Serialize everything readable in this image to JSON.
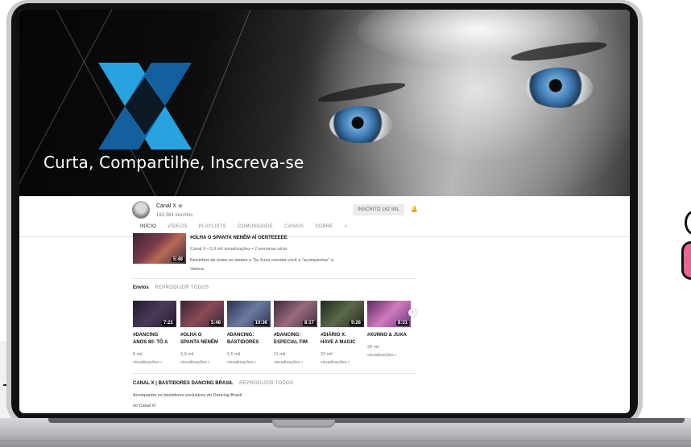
{
  "banner": {
    "tagline": "Curta, Compartilhe, Inscreva-se"
  },
  "channel": {
    "name": "Canal X",
    "subscribers": "162,384 inscritos",
    "subscribe_label": "INSCRITO 162 MIL",
    "tabs": [
      {
        "label": "INÍCIO",
        "active": true
      },
      {
        "label": "VÍDEOS",
        "active": false
      },
      {
        "label": "PLAYLISTS",
        "active": false
      },
      {
        "label": "COMUNIDADE",
        "active": false
      },
      {
        "label": "CANAIS",
        "active": false
      },
      {
        "label": "SOBRE",
        "active": false
      }
    ]
  },
  "featured": {
    "title": "#OLHA O SPANTA NENÊM AÍ GENTEEEEE",
    "meta": "Canal X • 5,9 mil visualizações • 2 semanas atrás",
    "description": "Baixinhos de todas as idades e Tia Xuxa convida você a \"acompanhar\" a Vateca.",
    "duration": "5:48"
  },
  "uploads": {
    "title": "Envios",
    "play_all": "REPRODUZIR TODOS",
    "videos": [
      {
        "title_line1": "#DANCING",
        "title_line2": "ANOS 80: TÔ A",
        "views": "8 mil",
        "views_label": "visualizações •",
        "duration": "7:21"
      },
      {
        "title_line1": "#OLHA O",
        "title_line2": "SPANTA NENÊM",
        "views": "5,9 mil",
        "views_label": "visualizações •",
        "duration": "5:48"
      },
      {
        "title_line1": "#DANCING:",
        "title_line2": "BASTIDORES",
        "views": "9,5 mil",
        "views_label": "visualizações •",
        "duration": "10:36"
      },
      {
        "title_line1": "#DANCING:",
        "title_line2": "ESPECIAL FIM",
        "views": "11 mil",
        "views_label": "visualizações •",
        "duration": "8:17"
      },
      {
        "title_line1": "#DIÁRIO X:",
        "title_line2": "HAVE A MAGIC",
        "views": "33 mil",
        "views_label": "visualizações •",
        "duration": "9:26"
      },
      {
        "title_line1": "#XUNNO & JUXA",
        "title_line2": "",
        "views": "28 mil",
        "views_label": "visualizações •",
        "duration": "8:31"
      }
    ]
  },
  "playlist": {
    "title": "CANAL X | BASTIDORES DANCING BRASIL",
    "play_all": "REPRODUZIR TODOS",
    "desc_line1": "Acompanhe os bastidores exclusivos do Dancing Brasil",
    "desc_line2": "no Canal X!"
  },
  "colors": {
    "logo_blue": "#29a3e0",
    "logo_dark_blue": "#1565a8",
    "accent_pink": "#f06292"
  }
}
